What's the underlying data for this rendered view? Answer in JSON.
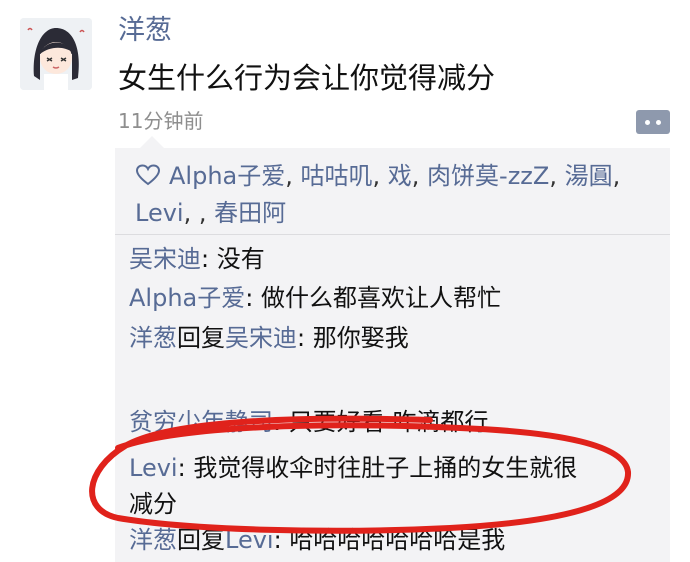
{
  "post": {
    "username": "洋葱",
    "text": "女生什么行为会让你觉得减分",
    "timestamp": "11分钟前",
    "more_icon": "ellipsis-icon"
  },
  "likes": {
    "icon": "heart-icon",
    "names": [
      "Alpha子爱",
      "咕咕叽",
      "戏",
      "肉饼莫-zzZ",
      "湯圓",
      "Levi",
      "",
      "春田阿"
    ]
  },
  "comments": [
    {
      "author": "吴宋迪",
      "sep": ": ",
      "text": "没有"
    },
    {
      "author": "Alpha子爱",
      "sep": ": ",
      "text": "做什么都喜欢让人帮忙"
    },
    {
      "author": "洋葱",
      "reply_word": "回复",
      "reply_to": "吴宋迪",
      "sep": ": ",
      "text": "那你娶我"
    },
    {
      "author": "贫穷少年静司",
      "sep": ": ",
      "text": "只要好看 咋滴都行"
    },
    {
      "author": "Levi",
      "sep": ": ",
      "text": "我觉得收伞时往肚子上捅的女生就很减分"
    },
    {
      "author": "洋葱",
      "reply_word": "回复",
      "reply_to": "Levi",
      "sep": ": ",
      "text": "哈哈哈哈哈哈哈是我"
    }
  ],
  "annotation": {
    "color": "#e0221b"
  },
  "colors": {
    "link": "#576b95",
    "panel": "#f3f3f5",
    "text": "#111111",
    "muted": "#8e8e8e"
  }
}
